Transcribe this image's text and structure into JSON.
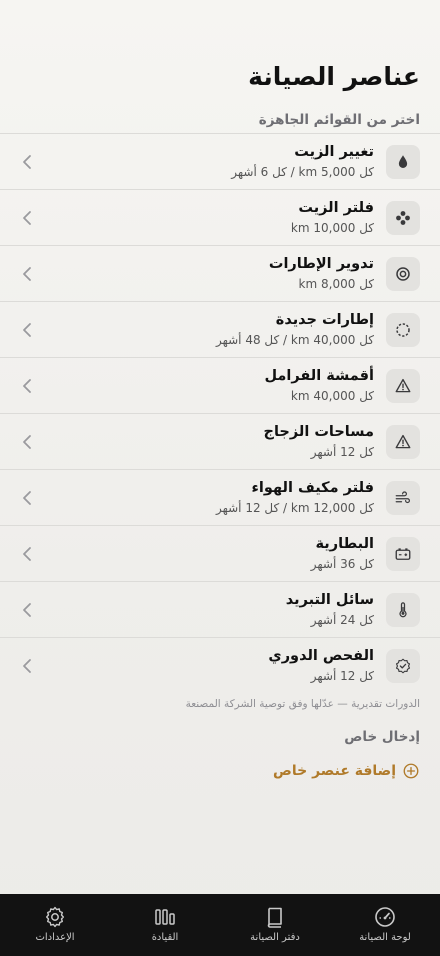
{
  "header": {
    "title": "عناصر الصيانة",
    "presets_label": "اختر من القوائم الجاهزة"
  },
  "items": [
    {
      "title": "تغيير الزيت",
      "subtitle": "كل 5,000 km / كل 6 أشهر",
      "icon": "drop-icon"
    },
    {
      "title": "فلتر الزيت",
      "subtitle": "كل 10,000 km",
      "icon": "filter-icon"
    },
    {
      "title": "تدوير الإطارات",
      "subtitle": "كل 8,000 km",
      "icon": "tire-icon"
    },
    {
      "title": "إطارات جديدة",
      "subtitle": "كل 40,000 km / كل 48 أشهر",
      "icon": "dashed-circle-icon"
    },
    {
      "title": "أقمشة الفرامل",
      "subtitle": "كل 40,000 km",
      "icon": "warning-icon"
    },
    {
      "title": "مساحات الزجاج",
      "subtitle": "كل 12 أشهر",
      "icon": "warning-icon"
    },
    {
      "title": "فلتر مكيف الهواء",
      "subtitle": "كل 12,000 km / كل 12 أشهر",
      "icon": "wind-icon"
    },
    {
      "title": "البطارية",
      "subtitle": "كل 36 أشهر",
      "icon": "battery-icon"
    },
    {
      "title": "سائل التبريد",
      "subtitle": "كل 24 أشهر",
      "icon": "thermometer-icon"
    },
    {
      "title": "الفحص الدوري",
      "subtitle": "كل 12 أشهر",
      "icon": "check-badge-icon"
    }
  ],
  "note": "الدورات تقديرية — عدّلها وفق توصية الشركة المصنعة",
  "custom": {
    "label": "إدخال خاص",
    "add_label": "إضافة عنصر خاص"
  },
  "tabs": [
    {
      "label": "لوحة الصيانة",
      "icon": "gauge-icon"
    },
    {
      "label": "دفتر الصيانة",
      "icon": "book-icon"
    },
    {
      "label": "القيادة",
      "icon": "bars-icon"
    },
    {
      "label": "الإعدادات",
      "icon": "gear-icon"
    }
  ],
  "colors": {
    "accent": "#b07a2a",
    "tabbar": "#121212",
    "icon_bg": "#e3e2df"
  }
}
